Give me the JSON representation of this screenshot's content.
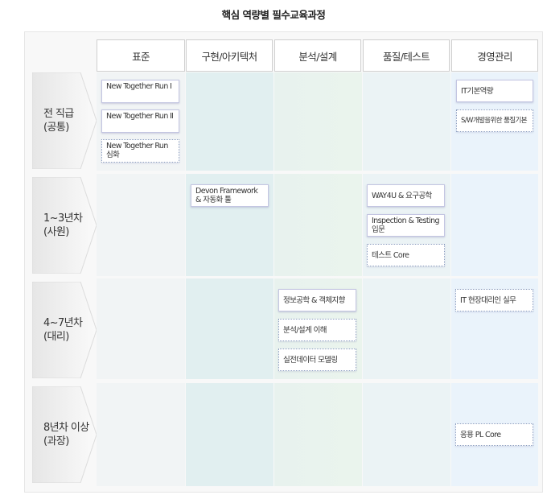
{
  "title": "핵심 역량별 필수교육과정",
  "columns": [
    "표준",
    "구현/아키텍처",
    "분석/설계",
    "품질/테스트",
    "경영관리"
  ],
  "rows": [
    {
      "line1": "전 직급",
      "line2": "(공통)"
    },
    {
      "line1": "1~3년차",
      "line2": "(사원)"
    },
    {
      "line1": "4~7년차",
      "line2": "(대리)"
    },
    {
      "line1": "8년차 이상",
      "line2": "(과장)"
    }
  ],
  "courses": {
    "r0_standard": [
      {
        "label": "New Together Run Ⅰ",
        "style": "required"
      },
      {
        "label": "New Together Run Ⅱ",
        "style": "required"
      },
      {
        "label": "New Together Run 심화",
        "style": "optional"
      }
    ],
    "r0_management": [
      {
        "label": "IT기본역량",
        "style": "required"
      },
      {
        "label": "S/W개발을위한 품질기본",
        "style": "optional"
      }
    ],
    "r1_architecture": [
      {
        "label": "Devon Framework & 자동화 툴",
        "style": "required"
      }
    ],
    "r1_quality": [
      {
        "label": "WAY4U & 요구공학",
        "style": "required"
      },
      {
        "label": "Inspection & Testing 입문",
        "style": "required"
      },
      {
        "label": "테스트 Core",
        "style": "optional"
      }
    ],
    "r2_analysis": [
      {
        "label": "정보공학 & 객체지향",
        "style": "required"
      },
      {
        "label": "분석/설계 이해",
        "style": "optional"
      },
      {
        "label": "실전데이터 모델링",
        "style": "optional"
      }
    ],
    "r2_management": [
      {
        "label": "IT 현장대리인 실무",
        "style": "optional"
      }
    ],
    "r3_management": [
      {
        "label": "응용 PL Core",
        "style": "optional"
      }
    ]
  },
  "colors": {
    "col_standard": "#f1f4f5",
    "col_architecture": "#e1eff0",
    "col_analysis": "#e9f3ee",
    "col_quality": "#ebf3f5",
    "col_management": "#eaf3fb",
    "required_border": "#c4c6e2",
    "optional_border": "#8c9ec0"
  }
}
